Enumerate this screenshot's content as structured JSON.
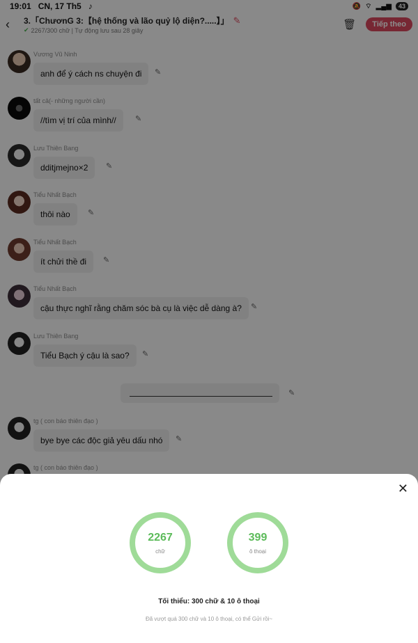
{
  "status": {
    "time": "19:01",
    "date": "CN, 17 Th5",
    "battery": "43"
  },
  "header": {
    "title": "3.「ChươnG 3:【hệ thống và lão quỷ lộ diện?.....】」",
    "subtitle": "2267/300 chữ | Tự động lưu sau 28 giây",
    "next_label": "Tiếp theo"
  },
  "messages": [
    {
      "name": "Vương Vũ Ninh",
      "text": "anh để ý cách ns chuyện đi"
    },
    {
      "name": "tất cả(- những người cần)",
      "text": "//tìm vị trí của mình//"
    },
    {
      "name": "Lưu Thiên Bang",
      "text": "dditjmejno×2"
    },
    {
      "name": "Tiểu Nhất Bạch",
      "text": "thôi nào"
    },
    {
      "name": "Tiểu Nhất Bạch",
      "text": "ít chửi thề đi"
    },
    {
      "name": "Tiểu Nhất Bạch",
      "text": "cậu thực nghĩ rằng chăm sóc bà cụ là việc dễ dàng à?"
    },
    {
      "name": "Lưu Thiên Bang",
      "text": "Tiểu Bạch ý cậu là sao?"
    },
    {
      "name": "tg ( con báo thiên đạo )",
      "text": "bye bye các độc giả yêu dấu nhó"
    },
    {
      "name": "tg ( con báo thiên đạo )",
      "text": ""
    }
  ],
  "sheet": {
    "words_count": "2267",
    "words_label": "chữ",
    "dialogs_count": "399",
    "dialogs_label": "ô thoại",
    "minimum_text": "Tối thiểu: 300 chữ & 10 ô thoại",
    "note_text": "Đã vượt quá 300 chữ và 10 ô thoại, có thể Gửi rồi~"
  },
  "colors": {
    "accent": "#d9485d",
    "ring": "#9fdb98",
    "ring_text": "#5cbb5a"
  },
  "icons": [
    "back-arrow-icon",
    "tiktok-icon",
    "mute-icon",
    "wifi-icon",
    "signal-icon",
    "edit-icon",
    "check-icon",
    "trash-icon",
    "pencil-icon",
    "close-icon"
  ]
}
